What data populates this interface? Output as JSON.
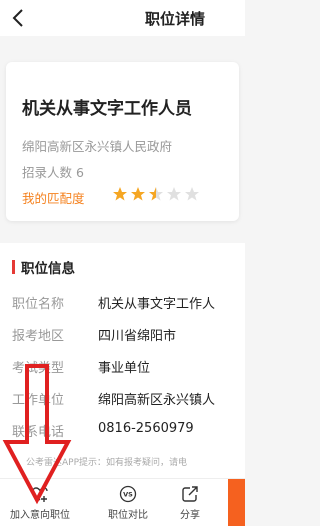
{
  "header": {
    "title": "职位详情",
    "back_icon": "chevron-left-icon"
  },
  "card": {
    "job_title": "机关从事文字工作人员",
    "employer": "绵阳高新区永兴镇人民政府",
    "recruit_count": "招录人数 6",
    "match_label": "我的匹配度",
    "match_rating": 2.5,
    "match_max": 5,
    "star_color": "#f5a623",
    "star_empty_color": "#e0e0e0"
  },
  "section": {
    "title": "职位信息",
    "rows": [
      {
        "key": "职位名称",
        "value": "机关从事文字工作人"
      },
      {
        "key": "报考地区",
        "value": "四川省绵阳市"
      },
      {
        "key": "考试类型",
        "value": "事业单位"
      },
      {
        "key": "工作单位",
        "value": "绵阳高新区永兴镇人"
      },
      {
        "key": "联系电话",
        "value": "0816-2560979"
      }
    ]
  },
  "tip": "公考雷达APP提示：如有报考疑问，请电",
  "bottom_bar": {
    "add_intent": "加入意向职位",
    "compare": "职位对比",
    "share": "分享"
  },
  "colors": {
    "accent": "#f5821f",
    "annotation_red": "#e02020",
    "apply": "#f5611f"
  }
}
